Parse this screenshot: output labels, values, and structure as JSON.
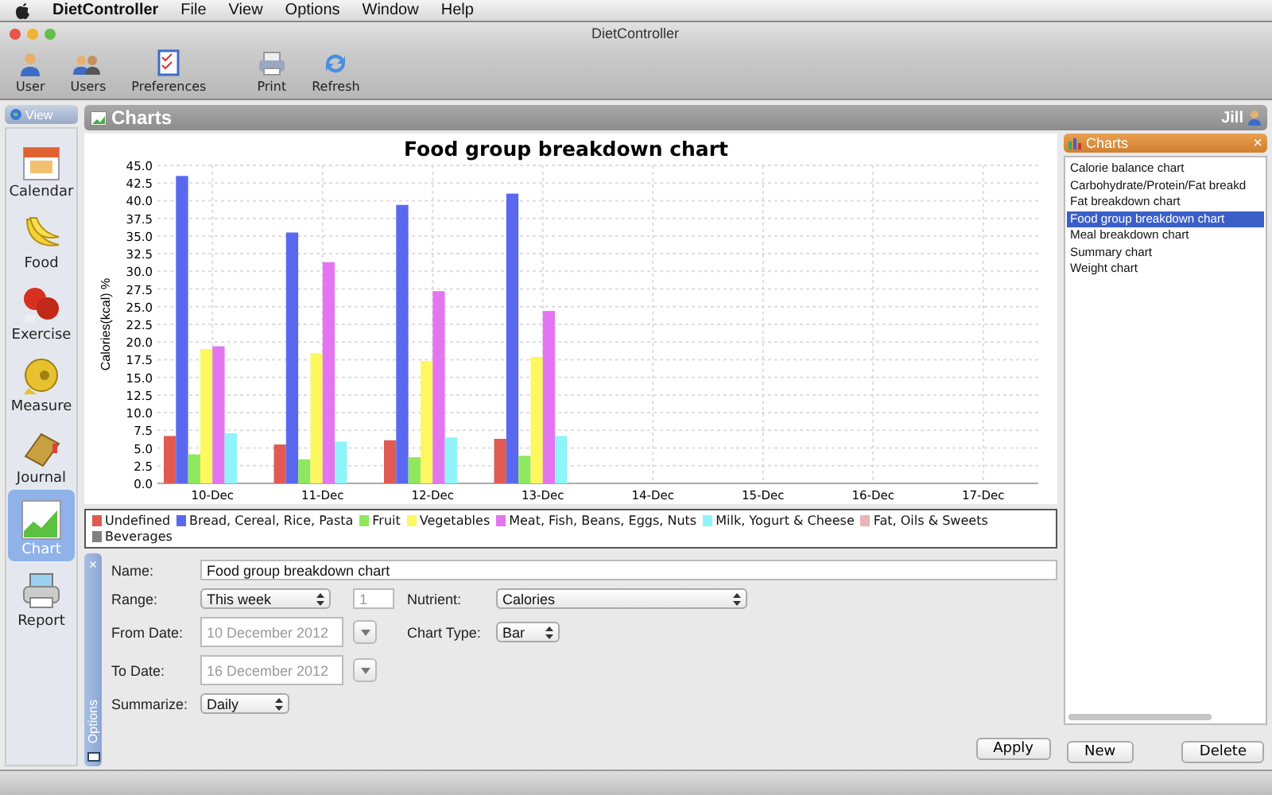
{
  "menu_bar": {
    "app": "DietController",
    "items": [
      "File",
      "View",
      "Options",
      "Window",
      "Help"
    ]
  },
  "window": {
    "title": "DietController"
  },
  "toolbar": [
    {
      "label": "User"
    },
    {
      "label": "Users"
    },
    {
      "label": "Preferences"
    },
    {
      "label": "Print"
    },
    {
      "label": "Refresh"
    }
  ],
  "sidebar": {
    "header": "View",
    "items": [
      {
        "label": "Calendar",
        "selected": false
      },
      {
        "label": "Food",
        "selected": false
      },
      {
        "label": "Exercise",
        "selected": false
      },
      {
        "label": "Measure",
        "selected": false
      },
      {
        "label": "Journal",
        "selected": false
      },
      {
        "label": "Chart",
        "selected": true
      },
      {
        "label": "Report",
        "selected": false
      }
    ]
  },
  "panel": {
    "title": "Charts",
    "user": "Jill"
  },
  "chart": {
    "chart_data": {
      "type": "bar",
      "grid": true,
      "title": "Food group breakdown chart",
      "ylabel": "Calories(kcal) %",
      "categories": [
        "10-Dec",
        "11-Dec",
        "12-Dec",
        "13-Dec",
        "14-Dec",
        "15-Dec",
        "16-Dec",
        "17-Dec"
      ],
      "ylim": [
        0,
        45
      ],
      "yticks": [
        {
          "value": 0,
          "label": "0.0"
        },
        {
          "value": 2.5,
          "label": "2.5"
        },
        {
          "value": 5,
          "label": "5.0"
        },
        {
          "value": 7.5,
          "label": "7.5"
        },
        {
          "value": 10,
          "label": "10.0"
        },
        {
          "value": 12.5,
          "label": "12.5"
        },
        {
          "value": 15,
          "label": "15.0"
        },
        {
          "value": 17.5,
          "label": "17.5"
        },
        {
          "value": 20,
          "label": "20.0"
        },
        {
          "value": 22.5,
          "label": "22.5"
        },
        {
          "value": 25,
          "label": "25.0"
        },
        {
          "value": 27.5,
          "label": "27.5"
        },
        {
          "value": 30,
          "label": "30.0"
        },
        {
          "value": 32.5,
          "label": "32.5"
        },
        {
          "value": 35,
          "label": "35.0"
        },
        {
          "value": 37.5,
          "label": "37.5"
        },
        {
          "value": 40,
          "label": "40.0"
        },
        {
          "value": 42.5,
          "label": "42.5"
        },
        {
          "value": 45,
          "label": "45.0"
        }
      ],
      "series": [
        {
          "name": "Undefined",
          "color": "#e05a52",
          "values": [
            6.7,
            5.5,
            6.1,
            6.3,
            null,
            null,
            null,
            null
          ]
        },
        {
          "name": "Bread, Cereal, Rice, Pasta",
          "color": "#5a68f0",
          "values": [
            43.5,
            35.5,
            39.4,
            41.0,
            null,
            null,
            null,
            null
          ]
        },
        {
          "name": "Fruit",
          "color": "#8ee85e",
          "values": [
            4.1,
            3.4,
            3.7,
            3.9,
            null,
            null,
            null,
            null
          ]
        },
        {
          "name": "Vegetables",
          "color": "#fdf760",
          "values": [
            19.0,
            18.4,
            17.3,
            17.9,
            null,
            null,
            null,
            null
          ]
        },
        {
          "name": "Meat, Fish, Beans, Eggs, Nuts",
          "color": "#e376f0",
          "values": [
            19.4,
            31.3,
            27.2,
            24.4,
            null,
            null,
            null,
            null
          ]
        },
        {
          "name": "Milk, Yogurt & Cheese",
          "color": "#8ef4fa",
          "values": [
            7.1,
            5.9,
            6.5,
            6.7,
            null,
            null,
            null,
            null
          ]
        },
        {
          "name": "Fat, Oils & Sweets",
          "color": "#e8b4b4",
          "values": [
            null,
            null,
            null,
            null,
            null,
            null,
            null,
            null
          ]
        },
        {
          "name": "Beverages",
          "color": "#808080",
          "values": [
            null,
            null,
            null,
            null,
            null,
            null,
            null,
            null
          ]
        }
      ]
    }
  },
  "options": {
    "tab_label": "Options",
    "close": "×",
    "name": {
      "label": "Name:",
      "value": "Food group breakdown chart"
    },
    "range": {
      "label": "Range:",
      "value": "This week",
      "count": "1"
    },
    "nutrient": {
      "label": "Nutrient:",
      "value": "Calories"
    },
    "from_date": {
      "label": "From Date:",
      "value": "10 December 2012",
      "disabled": true
    },
    "chart_type": {
      "label": "Chart Type:",
      "value": "Bar"
    },
    "to_date": {
      "label": "To Date:",
      "value": "16 December 2012",
      "disabled": true
    },
    "summarize": {
      "label": "Summarize:",
      "value": "Daily"
    },
    "apply": "Apply"
  },
  "charts_list": {
    "title": "Charts",
    "close": "×",
    "items": [
      {
        "label": "Calorie balance chart",
        "selected": false
      },
      {
        "label": "Carbohydrate/Protein/Fat breakd",
        "selected": false
      },
      {
        "label": "Fat breakdown chart",
        "selected": false
      },
      {
        "label": "Food group breakdown chart",
        "selected": true
      },
      {
        "label": "Meal breakdown chart",
        "selected": false
      },
      {
        "label": "Summary chart",
        "selected": false
      },
      {
        "label": "Weight chart",
        "selected": false
      }
    ],
    "buttons": [
      "New",
      "Delete"
    ]
  }
}
